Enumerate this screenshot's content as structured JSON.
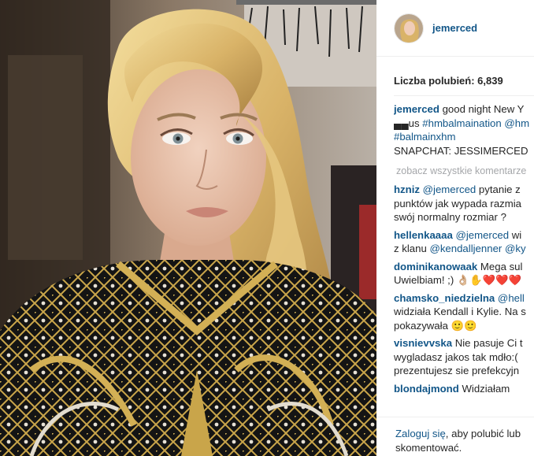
{
  "post": {
    "username": "jemerced",
    "likes_label": "Liczba polubień: 6,839"
  },
  "caption": {
    "user": "jemerced",
    "line1_text": "good night New Y",
    "line2_prefix": "▄▄us ",
    "line2_tag1": "#hmbalmaination",
    "line2_tag2": " @hm",
    "line3_tag": "#balmainxhm",
    "line4_text": "SNAPCHAT: JESSIMERCED"
  },
  "view_all_label": "zobacz wszystkie komentarze",
  "comments": [
    {
      "user": "hzniz",
      "mention": "@jemerced",
      "line1": " pytanie z",
      "line2": "punktów jak wypada razmia",
      "line3": "swój normalny rozmiar ?"
    },
    {
      "user": "hellenkaaaa",
      "mention": "@jemerced",
      "line1": " wi",
      "line2_prefix": "z klanu ",
      "line2_mention": "@kendalljenner",
      "line2_suffix": " @ky"
    },
    {
      "user": "dominikanowaak",
      "line1": " Mega sul",
      "line2": "Uwielbiam! ;) 👌🏼✋❤️❤️❤️"
    },
    {
      "user": "chamsko_niedzielna",
      "mention": " @hell",
      "line2": "widziała Kendall i Kylie. Na s",
      "line3": "pokazywała 🙂🙂"
    },
    {
      "user": "visnievvska",
      "line1": " Nie pasuje Ci t",
      "line2": "wygladasz jakos tak mdło:(",
      "line3": "prezentujesz sie prefekcyjn"
    },
    {
      "user": "blondajmond",
      "line1": " Widziałam"
    }
  ],
  "footer": {
    "login_link": "Zaloguj się",
    "text1": ", aby polubić lub",
    "text2": "skomentować."
  },
  "colors": {
    "link": "#125688",
    "text": "#262626",
    "muted": "#a5a7aa",
    "divider": "#efefef"
  }
}
